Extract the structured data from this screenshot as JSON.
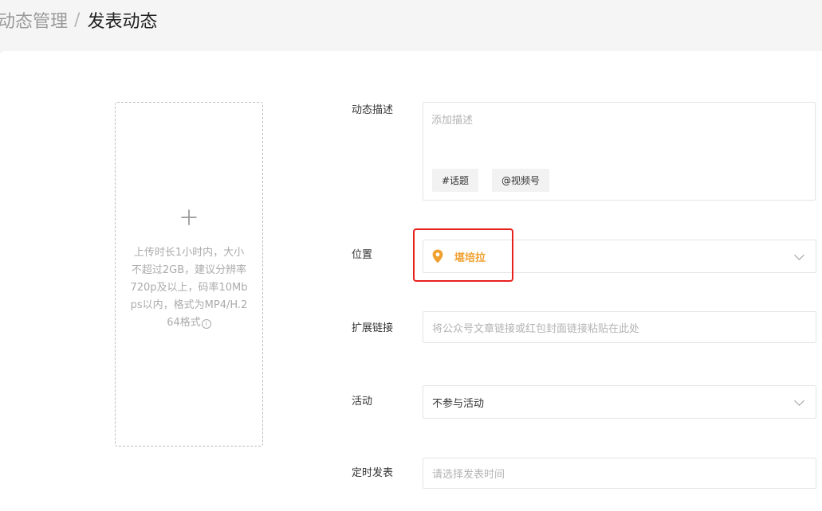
{
  "breadcrumb": {
    "parent": "动态管理",
    "separator": "/",
    "current": "发表动态"
  },
  "upload": {
    "hint": "上传时长1小时内，大小不超过2GB，建议分辨率720p及以上，码率10Mbps以内，格式为MP4/H.264格式"
  },
  "form": {
    "description": {
      "label": "动态描述",
      "placeholder": "添加描述",
      "topic_button": "#话题",
      "channel_button": "@视频号"
    },
    "location": {
      "label": "位置",
      "value": "堪培拉"
    },
    "link": {
      "label": "扩展链接",
      "placeholder": "将公众号文章链接或红包封面链接粘贴在此处"
    },
    "activity": {
      "label": "活动",
      "value": "不参与活动"
    },
    "schedule": {
      "label": "定时发表",
      "placeholder": "请选择发表时间"
    }
  },
  "colors": {
    "accent_orange": "#f0a030",
    "highlight_red": "#e8201c"
  }
}
